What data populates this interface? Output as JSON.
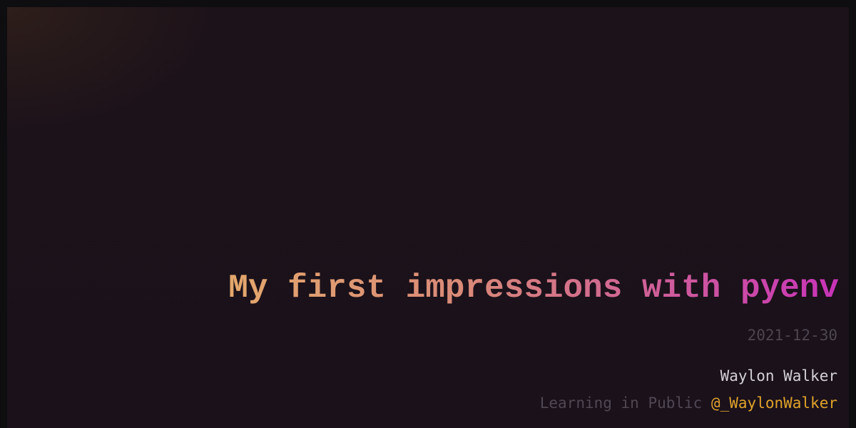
{
  "post": {
    "title": "My first impressions with pyenv",
    "date": "2021-12-30",
    "author": "Waylon Walker",
    "tagline": "Learning in Public",
    "handle": "@_WaylonWalker"
  },
  "colors": {
    "background": "#0e0d0f",
    "card": "#1b111a",
    "title_gradient_start": "#e4a86c",
    "title_gradient_end": "#c833b8",
    "date": "#4c4550",
    "author": "#d4d0d6",
    "tagline": "#4f4753",
    "handle": "#e0a32a"
  }
}
